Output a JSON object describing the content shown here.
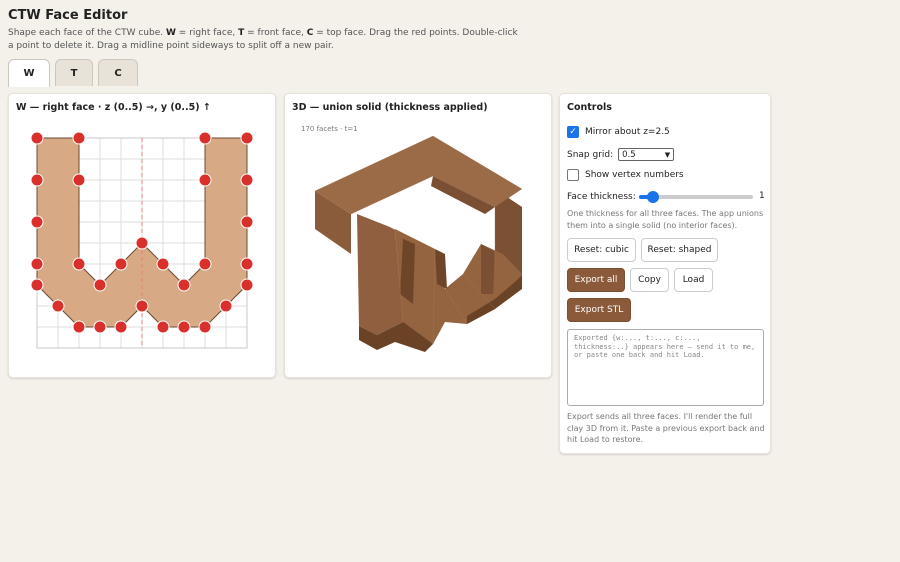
{
  "app": {
    "title": "CTW Face Editor",
    "desc_intro": "Shape each face of the CTW cube.",
    "desc_w_key": "W",
    "desc_w_text": "= right face,",
    "desc_t_key": "T",
    "desc_t_text": "= front face,",
    "desc_c_key": "C",
    "desc_c_text": "= top face. Drag the red points. Double-click a point to delete it. Drag a midline point sideways to split off a new pair."
  },
  "tabs": [
    {
      "label": "W"
    },
    {
      "label": "T"
    },
    {
      "label": "C"
    }
  ],
  "face_panel": {
    "title": "W — right face · z (0..5) →, y (0..5) ↑",
    "shape_color": "#d7a984",
    "point_color": "#d9302c",
    "midline_color": "#e38080"
  },
  "view_panel": {
    "title": "3D — union solid (thickness applied)",
    "facets": "170 facets · t=1",
    "solid_color": "#8a5a3a"
  },
  "controls": {
    "title": "Controls",
    "mirror_label": "Mirror about z=2.5",
    "mirror_checked": true,
    "snap_label": "Snap grid:",
    "snap_value": "0.5",
    "vertex_label": "Show vertex numbers",
    "vertex_checked": false,
    "thickness_label": "Face thickness:",
    "thickness_value": "1",
    "thickness_fraction": 0.12,
    "thickness_hint": "One thickness for all three faces. The app unions them into a single solid (no interior faces).",
    "reset_cubic": "Reset: cubic",
    "reset_shaped": "Reset: shaped",
    "export_all": "Export all",
    "copy": "Copy",
    "load": "Load",
    "export_stl": "Export STL",
    "export_placeholder": "Exported {w:..., t:..., c:..., thickness:..} appears here — send it to me, or paste one back and hit Load.",
    "export_hint": "Export sends all three faces. I'll render the full clay 3D from it. Paste a previous export back and hit Load to restore.",
    "accent_color": "#1a73e8",
    "primary_button_color": "#8a5a3a"
  }
}
